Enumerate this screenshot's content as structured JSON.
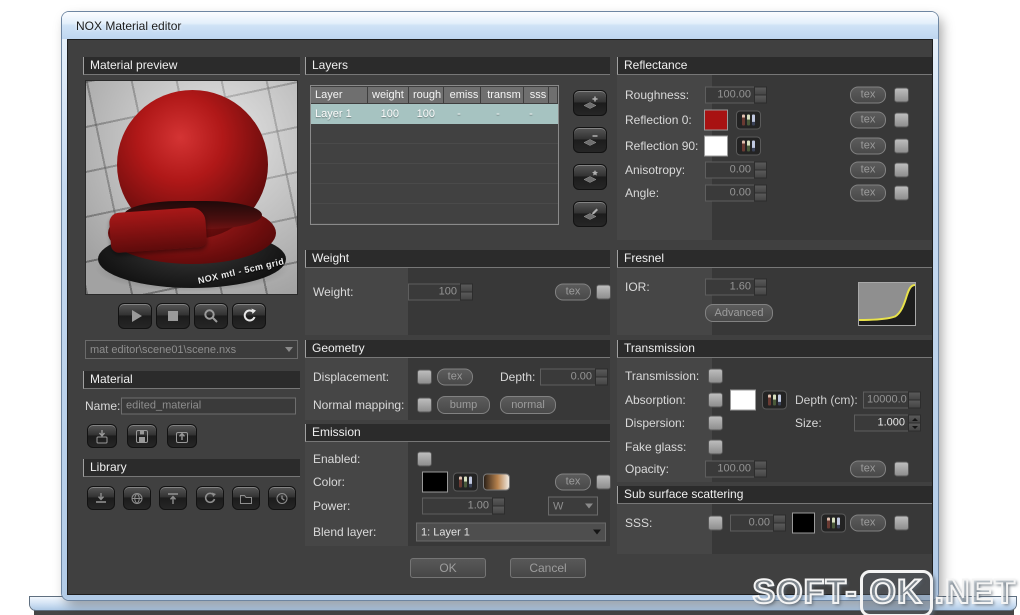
{
  "window": {
    "title": "NOX Material editor"
  },
  "labels": {
    "tex": "tex"
  },
  "preview": {
    "header": "Material preview",
    "ball_caption": "NOX mtl - 5cm grid",
    "scene_path": "mat editor\\scene01\\scene.nxs"
  },
  "material": {
    "header": "Material",
    "name_label": "Name:",
    "name_value": "edited_material"
  },
  "library": {
    "header": "Library"
  },
  "layers": {
    "header": "Layers",
    "columns": [
      "Layer",
      "weight",
      "rough",
      "emiss",
      "transm",
      "sss"
    ],
    "rows": [
      {
        "name": "Layer 1",
        "weight": "100",
        "rough": "100",
        "emiss": "-",
        "transm": "-",
        "sss": "-"
      }
    ]
  },
  "weight": {
    "header": "Weight",
    "label": "Weight:",
    "value": "100"
  },
  "geometry": {
    "header": "Geometry",
    "displacement_label": "Displacement:",
    "depth_label": "Depth:",
    "depth_value": "0.00",
    "normal_mapping_label": "Normal mapping:",
    "bump_label": "bump",
    "normal_label": "normal"
  },
  "emission": {
    "header": "Emission",
    "enabled_label": "Enabled:",
    "color_label": "Color:",
    "power_label": "Power:",
    "power_value": "1.00",
    "power_unit": "W",
    "blend_label": "Blend layer:",
    "blend_value": "1: Layer 1"
  },
  "reflectance": {
    "header": "Reflectance",
    "roughness_label": "Roughness:",
    "roughness_value": "100.00",
    "reflection0_label": "Reflection 0:",
    "reflection90_label": "Reflection 90:",
    "anisotropy_label": "Anisotropy:",
    "anisotropy_value": "0.00",
    "angle_label": "Angle:",
    "angle_value": "0.00"
  },
  "fresnel": {
    "header": "Fresnel",
    "ior_label": "IOR:",
    "ior_value": "1.60",
    "advanced_label": "Advanced"
  },
  "transmission": {
    "header": "Transmission",
    "transmission_label": "Transmission:",
    "absorption_label": "Absorption:",
    "depth_label": "Depth (cm):",
    "depth_value": "10000.0",
    "dispersion_label": "Dispersion:",
    "size_label": "Size:",
    "size_value": "1.000",
    "fake_glass_label": "Fake glass:",
    "opacity_label": "Opacity:",
    "opacity_value": "100.00"
  },
  "sss": {
    "header": "Sub surface scattering",
    "label": "SSS:",
    "value": "0.00"
  },
  "actions": {
    "ok": "OK",
    "cancel": "Cancel"
  },
  "watermark": {
    "soft": "SOFT-",
    "ok": "OK",
    "net": ".NET"
  },
  "colors": {
    "reflection0_swatch": "#a81212",
    "reflection90_swatch": "#ffffff",
    "emission_swatch": "#000000",
    "absorption_swatch": "#ffffff",
    "sss_swatch": "#000000",
    "selected_row": "#a6c3c1",
    "fresnel_curve": "#e8e24a",
    "preview_ball": "#a01010"
  },
  "icons": {
    "play": "css-triangle-right",
    "stop": "css-square",
    "magnifier": "svg-magnifier",
    "refresh": "svg-circular-arrow",
    "dropdown_arrow": "css-triangle-down",
    "spinner_up": "css-triangle-up",
    "spinner_down": "css-triangle-down",
    "add_layer": "svg-layer-plus",
    "remove_layer": "svg-layer-minus",
    "promote_layer": "svg-layer-star",
    "edit_layer": "svg-layer-pencil",
    "rgb_sliders": "three-vertical-slider-bars",
    "kelvin_gradient": "horizontal-color-gradient"
  }
}
